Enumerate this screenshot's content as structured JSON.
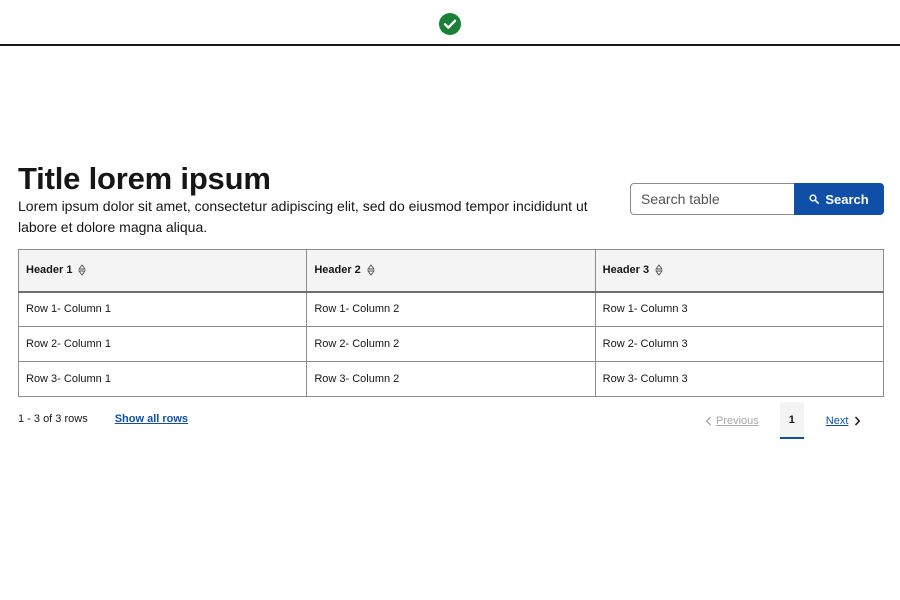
{
  "header": {
    "status_icon": "checkmark-circle-icon",
    "status_color": "#198038"
  },
  "main": {
    "title": "Title lorem ipsum",
    "description": "Lorem ipsum dolor sit amet, consectetur adipiscing elit, sed do eiusmod tempor incididunt ut labore et dolore magna aliqua."
  },
  "search": {
    "placeholder": "Search table",
    "button_label": "Search",
    "button_icon": "search-icon",
    "accent": "#0f4fa8"
  },
  "table": {
    "headers": [
      "Header 1",
      "Header 2",
      "Header 3"
    ],
    "sort_icon": "sort-icon",
    "rows": [
      [
        "Row 1- Column 1",
        "Row 1- Column 2",
        "Row 1- Column 3"
      ],
      [
        "Row 2- Column 1",
        "Row 2- Column 2",
        "Row 2- Column 3"
      ],
      [
        "Row 3- Column 1",
        "Row 3- Column 2",
        "Row 3- Column 3"
      ]
    ]
  },
  "footer": {
    "row_count": "1 - 3 of 3 rows",
    "show_all_label": "Show all rows"
  },
  "pagination": {
    "previous_label": "Previous",
    "current_page": "1",
    "next_label": "Next"
  }
}
